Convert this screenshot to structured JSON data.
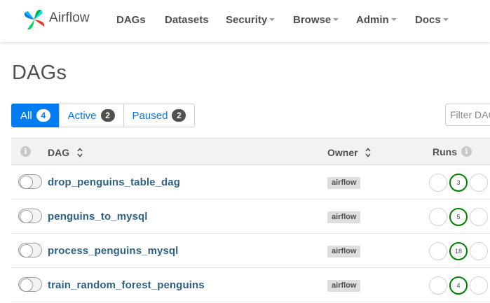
{
  "app": {
    "logo_text": "Airflow",
    "accent_color": "#017cee",
    "success_color": "#008000"
  },
  "nav": {
    "items": [
      {
        "label": "DAGs",
        "dropdown": false
      },
      {
        "label": "Datasets",
        "dropdown": false
      },
      {
        "label": "Security",
        "dropdown": true
      },
      {
        "label": "Browse",
        "dropdown": true
      },
      {
        "label": "Admin",
        "dropdown": true
      },
      {
        "label": "Docs",
        "dropdown": true
      }
    ]
  },
  "page": {
    "title": "DAGs"
  },
  "filters": {
    "tabs": [
      {
        "label": "All",
        "count": "4",
        "active": true
      },
      {
        "label": "Active",
        "count": "2",
        "active": false
      },
      {
        "label": "Paused",
        "count": "2",
        "active": false
      }
    ],
    "search_placeholder": "Filter DAGs by tag"
  },
  "table": {
    "columns": {
      "info": "i",
      "dag": "DAG",
      "owner": "Owner",
      "runs": "Runs"
    },
    "rows": [
      {
        "dag_id": "drop_penguins_table_dag",
        "owner": "airflow",
        "paused": true,
        "success_runs": "3"
      },
      {
        "dag_id": "penguins_to_mysql",
        "owner": "airflow",
        "paused": true,
        "success_runs": "5"
      },
      {
        "dag_id": "process_penguins_mysql",
        "owner": "airflow",
        "paused": true,
        "success_runs": "18"
      },
      {
        "dag_id": "train_random_forest_penguins",
        "owner": "airflow",
        "paused": true,
        "success_runs": "4"
      }
    ]
  }
}
